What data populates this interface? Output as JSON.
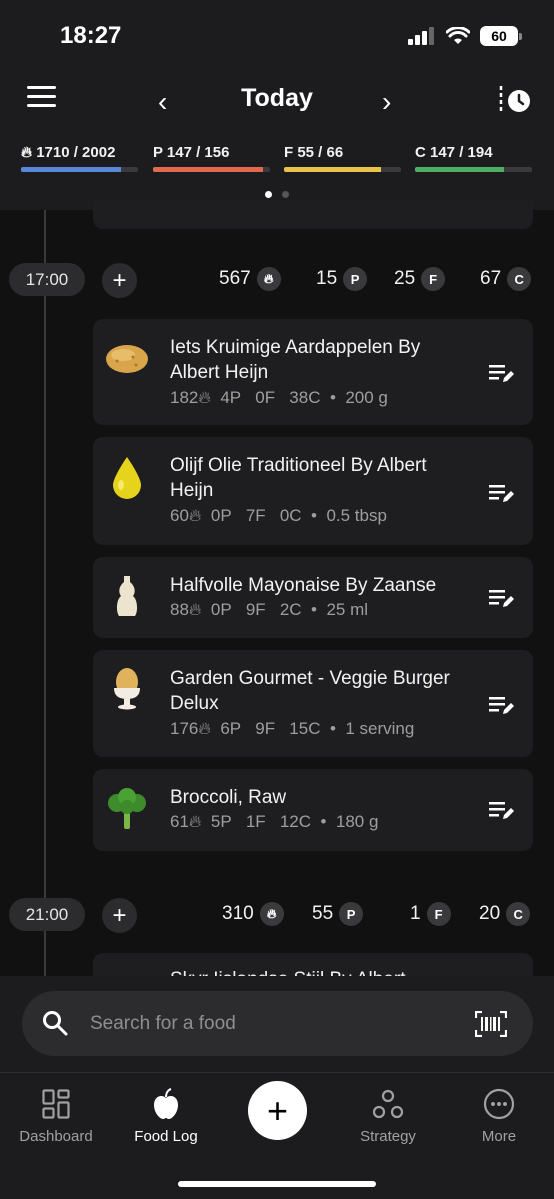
{
  "status": {
    "time": "18:27",
    "battery": "60"
  },
  "nav": {
    "title": "Today",
    "prev": "‹",
    "next": "›"
  },
  "macros": [
    {
      "label": "1710 / 2002",
      "prefix_icon": "flame-icon",
      "progress": 0.854,
      "color": "#5b87d9"
    },
    {
      "label": "P 147 / 156",
      "progress": 0.942,
      "color": "#e06a4f"
    },
    {
      "label": "F 55 / 66",
      "progress": 0.833,
      "color": "#e8c34a"
    },
    {
      "label": "C 147 / 194",
      "progress": 0.758,
      "color": "#4fae63"
    }
  ],
  "carousel": {
    "pages": 2,
    "active": 0
  },
  "meals": [
    {
      "time": "17:00",
      "add": "+",
      "stats": {
        "kcal": "567",
        "p": "15",
        "f": "25",
        "c": "67"
      },
      "foods": [
        {
          "name": "Iets Kruimige Aardappelen By Albert Heijn",
          "kcal": "182",
          "p": "4P",
          "f": "0F",
          "c": "38C",
          "amount": "200 g",
          "icon": "potato-icon"
        },
        {
          "name": "Olijf Olie Traditioneel By Albert Heijn",
          "kcal": "60",
          "p": "0P",
          "f": "7F",
          "c": "0C",
          "amount": "0.5 tbsp",
          "icon": "oil-drop-icon"
        },
        {
          "name": "Halfvolle Mayonaise By Zaanse",
          "kcal": "88",
          "p": "0P",
          "f": "9F",
          "c": "2C",
          "amount": "25 ml",
          "icon": "mayonnaise-bottle-icon"
        },
        {
          "name": "Garden Gourmet - Veggie Burger Delux",
          "kcal": "176",
          "p": "6P",
          "f": "9F",
          "c": "15C",
          "amount": "1 serving",
          "icon": "egg-cup-icon"
        },
        {
          "name": "Broccoli, Raw",
          "kcal": "61",
          "p": "5P",
          "f": "1F",
          "c": "12C",
          "amount": "180 g",
          "icon": "broccoli-icon"
        }
      ]
    },
    {
      "time": "21:00",
      "add": "+",
      "stats": {
        "kcal": "310",
        "p": "55",
        "f": "1",
        "c": "20"
      },
      "partial_food": "Skyr Ijslandse Stijl By Albert"
    }
  ],
  "badges": {
    "p": "P",
    "f": "F",
    "c": "C"
  },
  "separator": "•",
  "search": {
    "placeholder": "Search for a food"
  },
  "tabs": [
    {
      "label": "Dashboard",
      "icon": "dashboard-icon",
      "active": false
    },
    {
      "label": "Food Log",
      "icon": "apple-icon",
      "active": true
    },
    {
      "label": "Strategy",
      "icon": "strategy-icon",
      "active": false
    },
    {
      "label": "More",
      "icon": "more-icon",
      "active": false
    }
  ],
  "fab": "+"
}
